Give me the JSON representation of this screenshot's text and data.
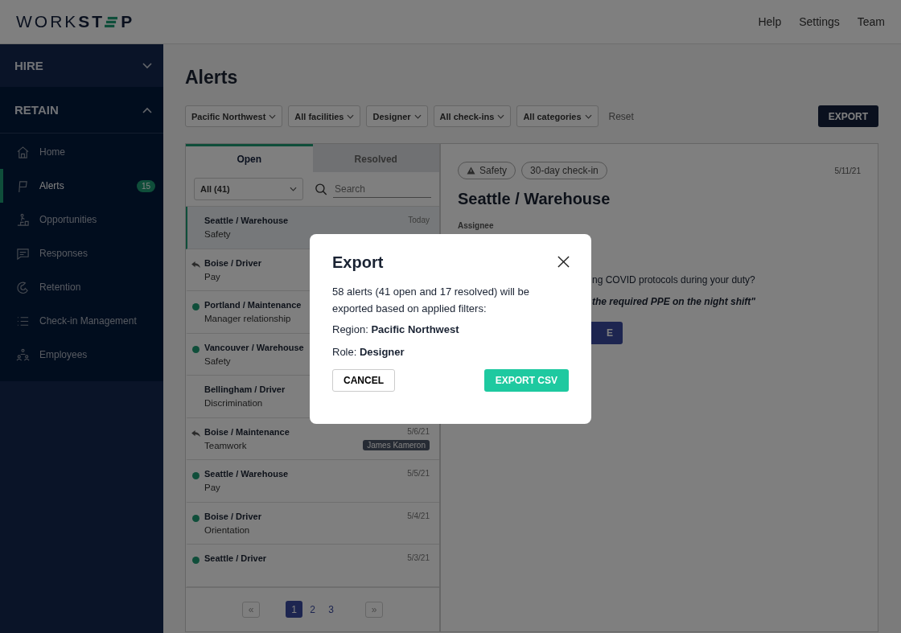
{
  "header": {
    "logo_light": "WORK",
    "logo_bold": "ST",
    "logo_tail": "P",
    "nav": [
      "Help",
      "Settings",
      "Team"
    ]
  },
  "sidebar": {
    "sections": [
      {
        "label": "HIRE",
        "expanded": false
      },
      {
        "label": "RETAIN",
        "expanded": true,
        "items": [
          {
            "label": "Home",
            "selected": false
          },
          {
            "label": "Alerts",
            "selected": true,
            "badge": "15"
          },
          {
            "label": "Opportunities",
            "selected": false
          },
          {
            "label": "Responses",
            "selected": false
          },
          {
            "label": "Retention",
            "selected": false
          },
          {
            "label": "Check-in Management",
            "selected": false
          },
          {
            "label": "Employees",
            "selected": false
          }
        ]
      }
    ]
  },
  "page": {
    "title": "Alerts",
    "filters": [
      "Pacific Northwest",
      "All facilities",
      "Designer",
      "All check-ins",
      "All categories"
    ],
    "reset": "Reset",
    "export": "EXPORT"
  },
  "list": {
    "tabs": [
      {
        "label": "Open",
        "selected": true
      },
      {
        "label": "Resolved",
        "selected": false
      }
    ],
    "status_filter": "All (41)",
    "search_placeholder": "Search",
    "rows": [
      {
        "title": "Seattle / Warehouse",
        "subtitle": "Safety",
        "date": "Today",
        "unread": false,
        "replied": false,
        "selected": true
      },
      {
        "title": "Boise / Driver",
        "subtitle": "Pay",
        "unread": false,
        "replied": true,
        "selected": false
      },
      {
        "title": "Portland / Maintenance",
        "subtitle": "Manager relationship",
        "unread": true,
        "replied": false,
        "selected": false
      },
      {
        "title": "Vancouver / Warehouse",
        "subtitle": "Safety",
        "unread": true,
        "replied": false,
        "selected": false
      },
      {
        "title": "Bellingham / Driver",
        "subtitle": "Discrimination",
        "unread": false,
        "replied": false,
        "selected": false
      },
      {
        "title": "Boise / Maintenance",
        "subtitle": "Teamwork",
        "date": "5/6/21",
        "unread": false,
        "replied": true,
        "selected": false,
        "assignee": "James Kameron"
      },
      {
        "title": "Seattle / Warehouse",
        "subtitle": "Pay",
        "date": "5/5/21",
        "unread": true,
        "replied": false,
        "selected": false
      },
      {
        "title": "Boise / Driver",
        "subtitle": "Orientation",
        "date": "5/4/21",
        "unread": true,
        "replied": false,
        "selected": false
      },
      {
        "title": "Seattle / Driver",
        "date": "5/3/21",
        "unread": true,
        "replied": false,
        "selected": false
      }
    ],
    "pager": {
      "first": "«",
      "last": "»",
      "pages": [
        {
          "label": "1",
          "selected": true
        },
        {
          "label": "2",
          "selected": false
        },
        {
          "label": "3",
          "selected": false
        }
      ]
    }
  },
  "detail": {
    "tags": [
      {
        "label": "Safety",
        "kind": "warning"
      },
      {
        "label": "30-day check-in",
        "kind": "plain"
      }
    ],
    "date": "5/11/21",
    "title": "Seattle / Warehouse",
    "assignee_label": "Assignee",
    "question": "ng COVID protocols during your duty?",
    "answer": "the required PPE on the night shift\"",
    "button": "E"
  },
  "modal": {
    "title": "Export",
    "message": "58 alerts (41 open and 17 resolved) will be exported based on applied filters:",
    "filters": [
      {
        "label": "Region:",
        "value": "Pacific Northwest"
      },
      {
        "label": "Role:",
        "value": "Designer"
      }
    ],
    "cancel": "CANCEL",
    "confirm": "EXPORT CSV"
  }
}
